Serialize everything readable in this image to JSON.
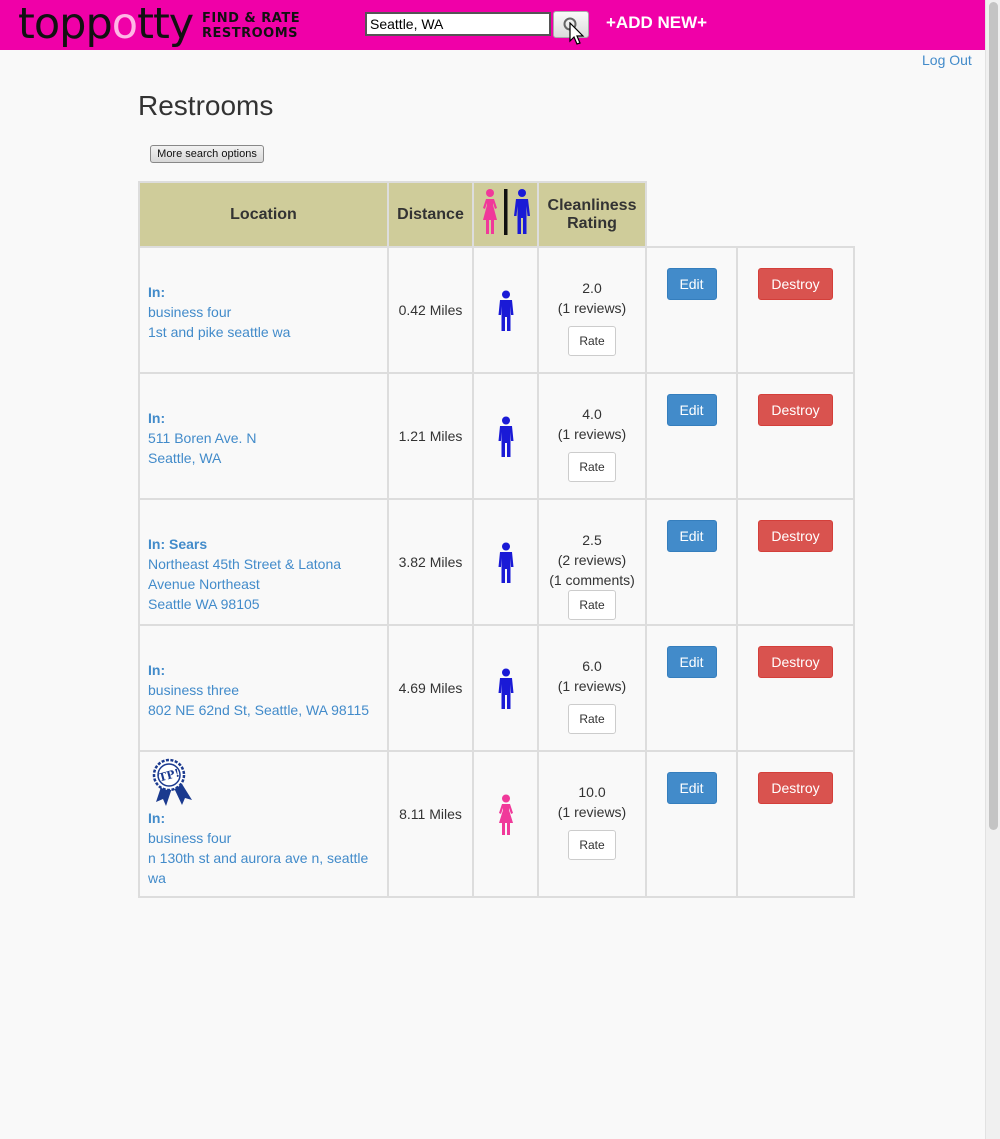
{
  "brand": {
    "logo_text": "toppotty",
    "logo_part1": "topp",
    "logo_part2": "o",
    "logo_part3": "tty",
    "tagline_line1": "FIND & RATE",
    "tagline_line2": "RESTROOMS",
    "color": "#f000a8"
  },
  "search": {
    "value": "Seattle, WA",
    "button_icon": "magnifier-icon"
  },
  "nav": {
    "add_new": "+ADD NEW+",
    "logout": "Log Out"
  },
  "page": {
    "title": "Restrooms",
    "more_options": "More search options"
  },
  "table": {
    "headers": {
      "location": "Location",
      "distance": "Distance",
      "gender_icon": "restroom-icon",
      "cleanliness_line1": "Cleanliness",
      "cleanliness_line2": "Rating"
    },
    "rows": [
      {
        "prefix": "In:",
        "addr1": "business four",
        "addr2": "1st and pike seattle wa",
        "addr3": "",
        "distance": "0.42 Miles",
        "gender": "male",
        "rating": "2.0",
        "reviews": "(1 reviews)",
        "comments": "",
        "rate": "Rate",
        "edit": "Edit",
        "destroy": "Destroy",
        "badge": false
      },
      {
        "prefix": "In:",
        "addr1": "511 Boren Ave. N",
        "addr2": "Seattle, WA",
        "addr3": "",
        "distance": "1.21 Miles",
        "gender": "male",
        "rating": "4.0",
        "reviews": "(1 reviews)",
        "comments": "",
        "rate": "Rate",
        "edit": "Edit",
        "destroy": "Destroy",
        "badge": false
      },
      {
        "prefix": "In: Sears",
        "addr1": "Northeast 45th Street & Latona",
        "addr2": "Avenue Northeast",
        "addr3": "Seattle WA 98105",
        "distance": "3.82 Miles",
        "gender": "male",
        "rating": "2.5",
        "reviews": "(2 reviews)",
        "comments": "(1 comments)",
        "rate": "Rate",
        "edit": "Edit",
        "destroy": "Destroy",
        "badge": false
      },
      {
        "prefix": "In:",
        "addr1": "business three",
        "addr2": "802 NE 62nd St, Seattle, WA 98115",
        "addr3": "",
        "distance": "4.69 Miles",
        "gender": "male",
        "rating": "6.0",
        "reviews": "(1 reviews)",
        "comments": "",
        "rate": "Rate",
        "edit": "Edit",
        "destroy": "Destroy",
        "badge": false
      },
      {
        "prefix": "In:",
        "addr1": "business four",
        "addr2": "n 130th st and aurora ave n, seattle",
        "addr3": "wa",
        "distance": "8.11 Miles",
        "gender": "female",
        "rating": "10.0",
        "reviews": "(1 reviews)",
        "comments": "",
        "rate": "Rate",
        "edit": "Edit",
        "destroy": "Destroy",
        "badge": true,
        "badge_text": "TP!"
      }
    ]
  },
  "colors": {
    "header_bg": "#cfcc9a",
    "link": "#428bca",
    "male": "#1a1ad6",
    "female": "#f0399a",
    "edit": "#428bca",
    "destroy": "#d9534f"
  }
}
